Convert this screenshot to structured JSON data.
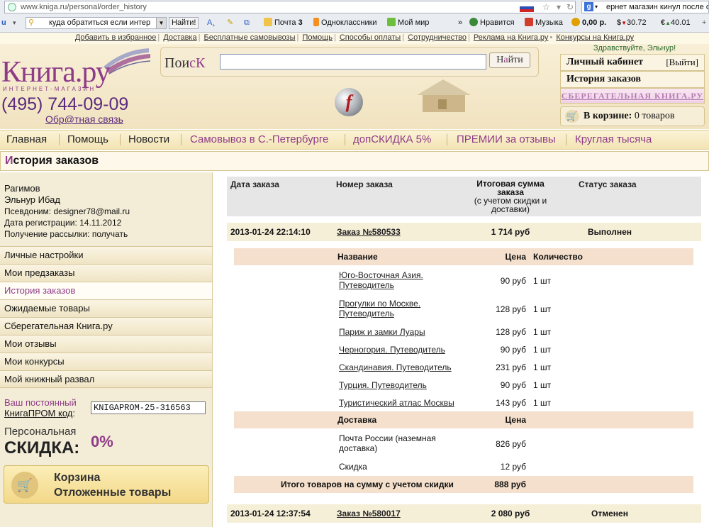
{
  "browser": {
    "url": "www.kniga.ru/personal/order_history",
    "search_text": "ернет магазин кинул после оплаты",
    "toolbar_search": "куда обратиться если интер",
    "find_label": "Найти!",
    "mail_label": "Почта",
    "mail_count": "3",
    "odnoklassniki_label": "Одноклассники",
    "moimir_label": "Мой мир",
    "like_label": "Нравится",
    "music_label": "Музыка",
    "balance": "0,00 р.",
    "usd": "30.72",
    "eur": "40.01",
    "chevrons": "»"
  },
  "topnav": [
    "Добавить в избранное",
    "Доставка",
    "Бесплатные самовывозы",
    "Помощь",
    "Способы оплаты",
    "Сотрудничество",
    "Реклама на Книга.ру",
    "Конкурсы на Книга.ру"
  ],
  "header": {
    "logo": "Книга.ру",
    "logo_sub": "ИНТЕРНЕТ-МАГАЗИН",
    "phone": "(495) 744-09-09",
    "feedback": "Обр@тная связь",
    "search_label_a": "Пои",
    "search_label_b": "с",
    "search_label_c": "К",
    "search_value": "",
    "search_btn_a": "Н",
    "search_btn_b": "а",
    "search_btn_c": "йти",
    "flash_glyph": "f",
    "greeting": "Здравствуйте, Эльнур!",
    "cabinet": "Личный кабинет",
    "logout": "[Выйти]",
    "order_history": "История заказов",
    "savings_book": "СБЕРЕГАТЕЛЬНАЯ КНИГА.РУ",
    "cart_label": "В корзине:",
    "cart_value": "0 товаров"
  },
  "mainnav": [
    {
      "label": "Главная"
    },
    {
      "label": "Помощь"
    },
    {
      "label": "Новости"
    },
    {
      "label": "Самовывоз в С.-Петербурге"
    },
    {
      "label": "допСКИДКА 5%"
    },
    {
      "label": "ПРЕМИИ за отзывы"
    },
    {
      "label": "Круглая тысяча"
    }
  ],
  "page_title_first": "И",
  "page_title_rest": "стория заказов",
  "user": {
    "surname": "Рагимов",
    "name": "Эльнур Ибад",
    "nick": "Псевдоним: designer78@mail.ru",
    "registered": "Дата регистрации: 14.11.2012",
    "mailing": "Получение рассылки: получать"
  },
  "sidemenu": [
    "Личные настройки",
    "Мои предзаказы",
    "История заказов",
    "Ожидаемые товары",
    "Сберегательная Книга.ру",
    "Мои отзывы",
    "Мои конкурсы",
    "Мой книжный развал"
  ],
  "promo": {
    "line1": "Ваш постоянный",
    "line2": "КнигаПРОМ код",
    "colon": ":",
    "code": "KNIGAPROM-25-316563",
    "discount_label": "Персональная",
    "discount_big": "СКИДКА:",
    "discount_value": "0%"
  },
  "cartpanel": {
    "line1": "Корзина",
    "line2": "Отложенные товары"
  },
  "table": {
    "h_date": "Дата заказа",
    "h_num": "Номер заказа",
    "h_sum1": "Итоговая сумма",
    "h_sum2": "заказа",
    "h_sum3": "(с учетом скидки и",
    "h_sum4": "доставки)",
    "h_status": "Статус заказа"
  },
  "orders": [
    {
      "date": "2013-01-24 22:14:10",
      "number": "Заказ №580533",
      "sum": "1 714 руб",
      "status": "Выполнен"
    },
    {
      "date": "2013-01-24 12:37:54",
      "number": "Заказ №580017",
      "sum": "2 080 руб",
      "status": "Отменен"
    }
  ],
  "items_head": {
    "name": "Название",
    "price": "Цена",
    "qty": "Количество"
  },
  "items": [
    {
      "l1": "Юго-Восточная Азия.",
      "l2": "Путеводитель",
      "price": "90 руб",
      "qty": "1 шт"
    },
    {
      "l1": "Прогулки по Москве.",
      "l2": "Путеводитель",
      "price": "128 руб",
      "qty": "1 шт"
    },
    {
      "l1": "Париж и замки Луары",
      "l2": "",
      "price": "128 руб",
      "qty": "1 шт"
    },
    {
      "l1": "Черногория. Путеводитель",
      "l2": "",
      "price": "90 руб",
      "qty": "1 шт"
    },
    {
      "l1": "Скандинавия. Путеводитель",
      "l2": "",
      "price": "231 руб",
      "qty": "1 шт"
    },
    {
      "l1": "Турция. Путеводитель",
      "l2": "",
      "price": "90 руб",
      "qty": "1 шт"
    },
    {
      "l1": "Туристический атлас Москвы",
      "l2": "",
      "price": "143 руб",
      "qty": "1 шт"
    }
  ],
  "delivery_head": {
    "name": "Доставка",
    "price": "Цена"
  },
  "delivery": [
    {
      "l1": "Почта России (наземная",
      "l2": "доставка)",
      "price": "826 руб"
    },
    {
      "l1": "Скидка",
      "l2": "",
      "price": "12 руб"
    }
  ],
  "total": {
    "label": "Итого товаров на сумму с учетом скидки",
    "value": "888 руб"
  },
  "colors": {
    "brand": "#8e3b88",
    "header_bg": "#f3e4b4",
    "row_bg": "#f6efd8",
    "items_head_bg": "#f4e0cc"
  }
}
